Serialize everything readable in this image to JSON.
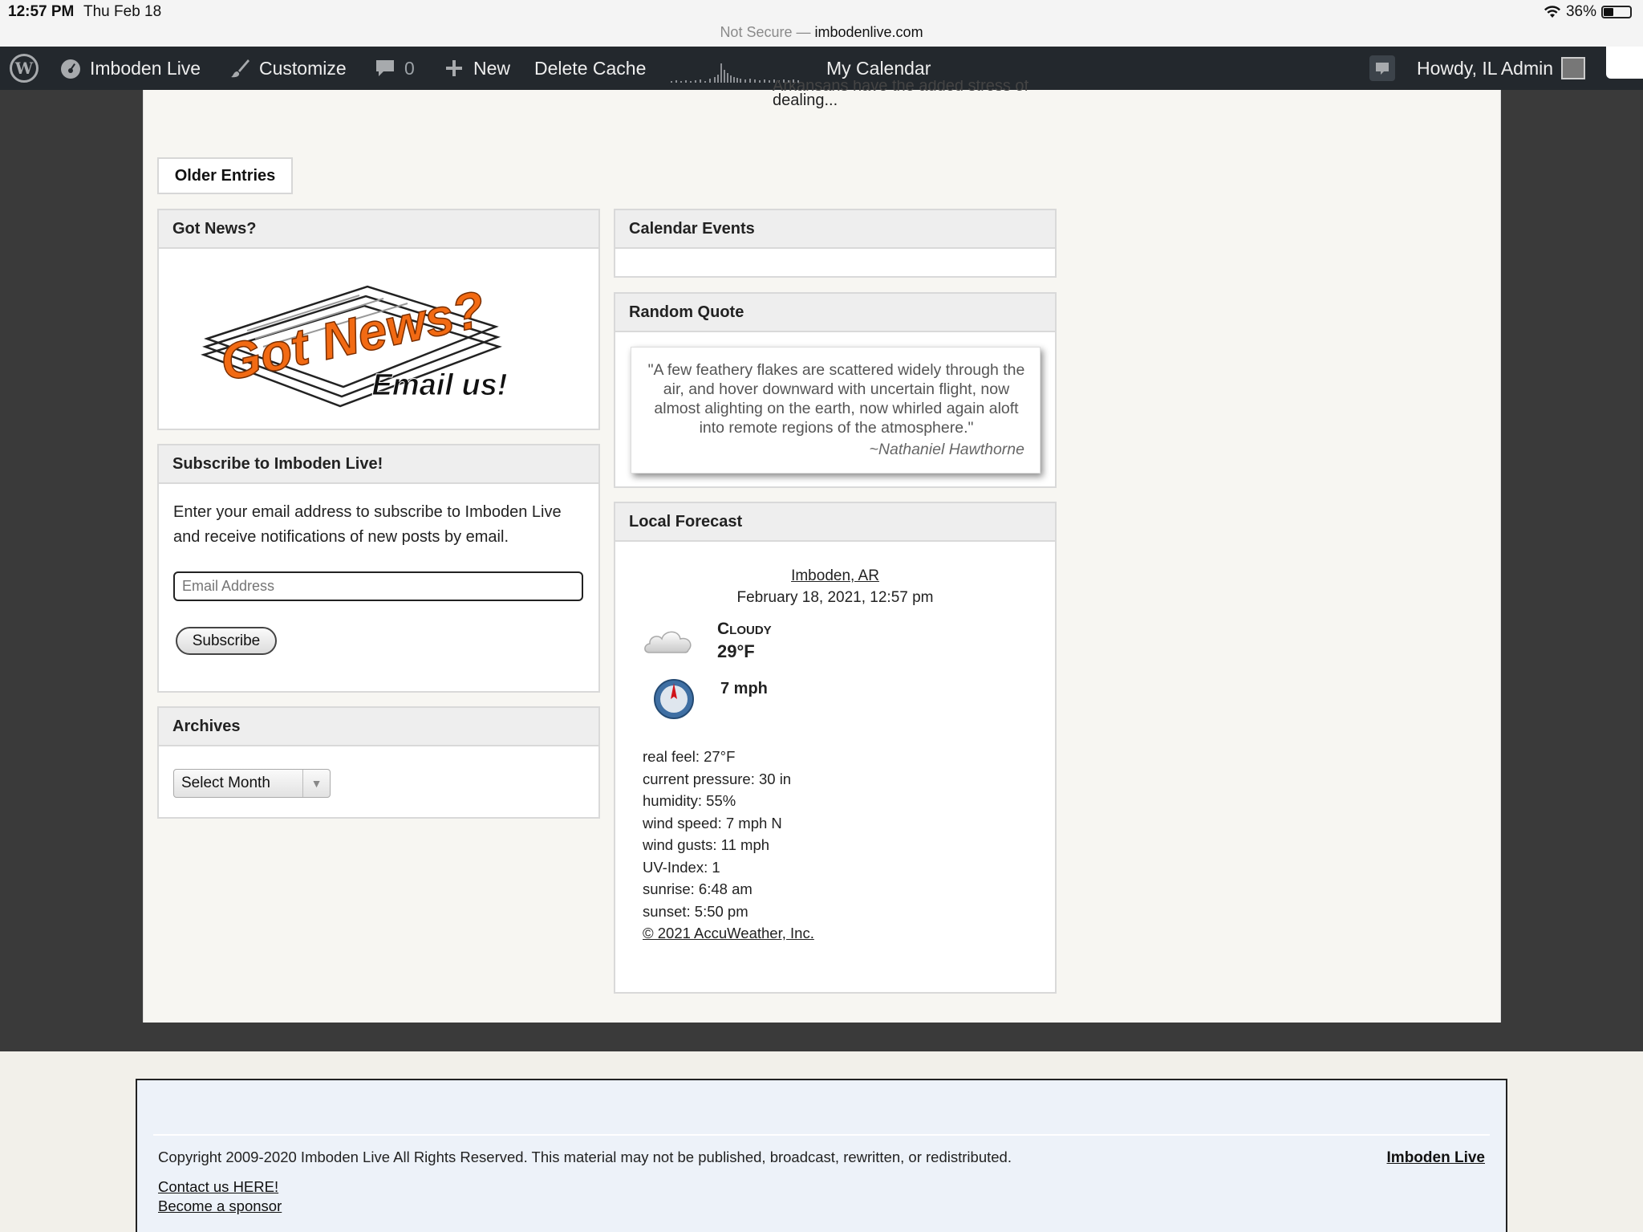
{
  "status_bar": {
    "time": "12:57 PM",
    "date": "Thu Feb 18",
    "battery": "36%",
    "battery_level": 0.36
  },
  "browser": {
    "not_secure": "Not Secure —",
    "domain": "imbodenlive.com"
  },
  "admin_bar": {
    "site_name": "Imboden Live",
    "customize": "Customize",
    "comments_count": "0",
    "new": "New",
    "delete_cache": "Delete Cache",
    "my_calendar": "My Calendar",
    "howdy": "Howdy, IL Admin"
  },
  "post_excerpt": {
    "cut_line": "Arkansans have the added stress of",
    "tail": "dealing..."
  },
  "older_entries": "Older Entries",
  "widgets": {
    "got_news": {
      "title": "Got News?",
      "art_main": "Got News?",
      "art_sub": "Email us!"
    },
    "subscribe": {
      "title": "Subscribe to Imboden Live!",
      "text": "Enter your email address to subscribe to Imboden Live and receive notifications of new posts by email.",
      "placeholder": "Email Address",
      "button": "Subscribe"
    },
    "archives": {
      "title": "Archives",
      "select_value": "Select Month"
    },
    "calendar": {
      "title": "Calendar Events"
    },
    "random_quote": {
      "title": "Random Quote",
      "quote": "\"A few feathery flakes are scattered widely through the air, and hover downward with uncertain flight, now almost alighting on the earth, now whirled again aloft into remote regions of the atmosphere.\"",
      "author": "~Nathaniel Hawthorne"
    },
    "forecast": {
      "title": "Local Forecast",
      "location": "Imboden, AR",
      "datetime": "February 18, 2021, 12:57 pm",
      "condition": "Cloudy",
      "temperature": "29°F",
      "wind": "7 mph",
      "details": [
        "real feel: 27°F",
        "current pressure: 30 in",
        "humidity: 55%",
        "wind speed: 7 mph N",
        "wind gusts: 11 mph",
        "UV-Index: 1",
        "sunrise: 6:48 am",
        "sunset: 5:50 pm"
      ],
      "credit": "© 2021 AccuWeather, Inc."
    }
  },
  "footer": {
    "copyright": "Copyright 2009-2020 Imboden Live All Rights Reserved. This material may not be published, broadcast, rewritten, or redistributed.",
    "contact": "Contact us HERE!",
    "sponsor": "Become a sponsor",
    "brand": "Imboden Live"
  },
  "colors": {
    "admin_bar": "#23282d",
    "frame": "#3a3a3a",
    "accent_orange": "#f26a13",
    "footer_bg": "#edf2f9"
  }
}
